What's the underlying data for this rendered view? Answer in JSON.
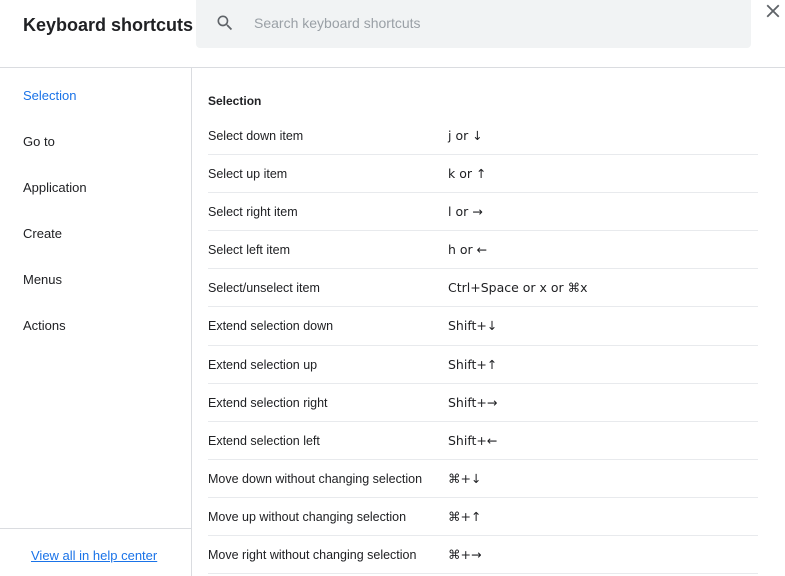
{
  "header": {
    "title": "Keyboard shortcuts",
    "search": {
      "placeholder": "Search keyboard shortcuts",
      "value": ""
    }
  },
  "sidebar": {
    "items": [
      {
        "label": "Selection",
        "active": true
      },
      {
        "label": "Go to",
        "active": false
      },
      {
        "label": "Application",
        "active": false
      },
      {
        "label": "Create",
        "active": false
      },
      {
        "label": "Menus",
        "active": false
      },
      {
        "label": "Actions",
        "active": false
      }
    ],
    "help_link": "View all in help center"
  },
  "main": {
    "section_title": "Selection",
    "shortcuts": [
      {
        "action": "Select down item",
        "keys": "j or ↓"
      },
      {
        "action": "Select up item",
        "keys": "k or ↑"
      },
      {
        "action": "Select right item",
        "keys": "l or →"
      },
      {
        "action": "Select left item",
        "keys": "h or ←"
      },
      {
        "action": "Select/unselect item",
        "keys": "Ctrl+Space or x or ⌘x"
      },
      {
        "action": "Extend selection down",
        "keys": "Shift+↓"
      },
      {
        "action": "Extend selection up",
        "keys": "Shift+↑"
      },
      {
        "action": "Extend selection right",
        "keys": "Shift+→"
      },
      {
        "action": "Extend selection left",
        "keys": "Shift+←"
      },
      {
        "action": "Move down without changing selection",
        "keys": "⌘+↓"
      },
      {
        "action": "Move up without changing selection",
        "keys": "⌘+↑"
      },
      {
        "action": "Move right without changing selection",
        "keys": "⌘+→"
      }
    ]
  },
  "colors": {
    "accent": "#1a73e8",
    "text": "#202124",
    "divider": "#dadce0",
    "search_bg": "#f1f3f4"
  },
  "icons": {
    "search": "search-icon",
    "close": "close-icon"
  }
}
